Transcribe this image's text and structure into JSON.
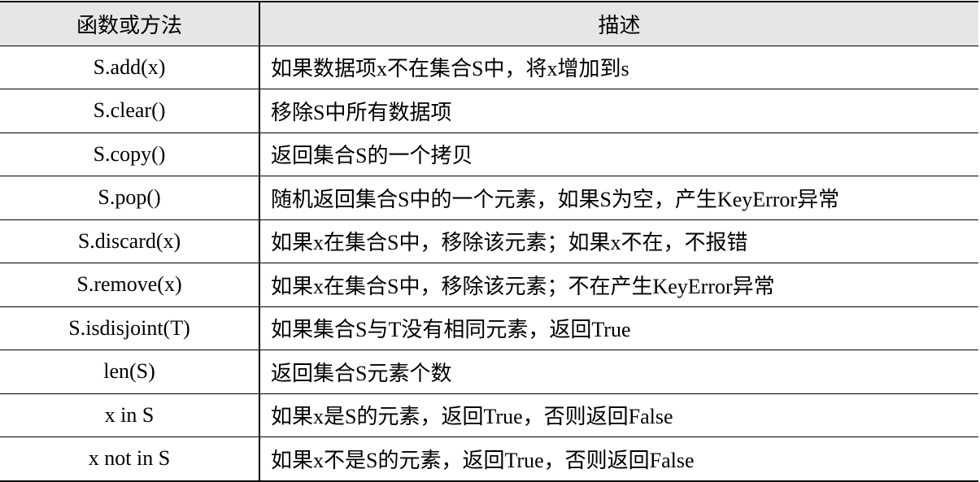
{
  "table": {
    "headers": [
      "函数或方法",
      "描述"
    ],
    "rows": [
      [
        "S.add(x)",
        "如果数据项x不在集合S中，将x增加到s"
      ],
      [
        "S.clear()",
        "移除S中所有数据项"
      ],
      [
        "S.copy()",
        "返回集合S的一个拷贝"
      ],
      [
        "S.pop()",
        "随机返回集合S中的一个元素，如果S为空，产生KeyError异常"
      ],
      [
        "S.discard(x)",
        "如果x在集合S中，移除该元素；如果x不在，不报错"
      ],
      [
        "S.remove(x)",
        "如果x在集合S中，移除该元素；不在产生KeyError异常"
      ],
      [
        "S.isdisjoint(T)",
        "如果集合S与T没有相同元素，返回True"
      ],
      [
        "len(S)",
        "返回集合S元素个数"
      ],
      [
        "x in S",
        "如果x是S的元素，返回True，否则返回False"
      ],
      [
        "x not in S",
        "如果x不是S的元素，返回True，否则返回False"
      ]
    ],
    "header_background": "#e6e6e6",
    "border_color": "#000000"
  }
}
